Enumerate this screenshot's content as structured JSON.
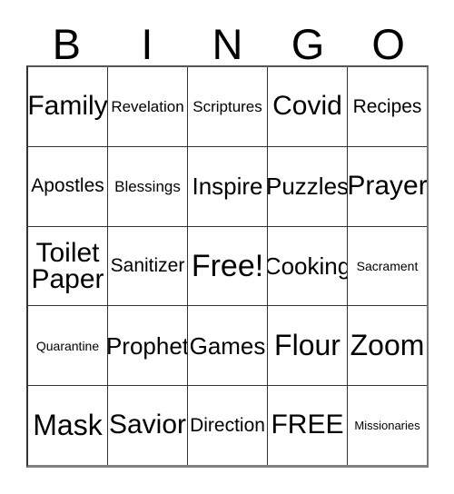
{
  "card": {
    "header_letters": [
      "B",
      "I",
      "N",
      "G",
      "O"
    ],
    "colors": {
      "background": "#ffffff",
      "text": "#000000",
      "grid_line": "#333333",
      "outer_border_bottom": "#808080"
    },
    "rows": [
      [
        {
          "text": "Family",
          "size": "lg"
        },
        {
          "text": "Revelation",
          "size": "xs"
        },
        {
          "text": "Scriptures",
          "size": "xs"
        },
        {
          "text": "Covid",
          "size": "lg"
        },
        {
          "text": "Recipes",
          "size": "sm"
        }
      ],
      [
        {
          "text": "Apostles",
          "size": "sm"
        },
        {
          "text": "Blessings",
          "size": "xs"
        },
        {
          "text": "Inspire",
          "size": "md"
        },
        {
          "text": "Puzzles",
          "size": "md"
        },
        {
          "text": "Prayer",
          "size": "lg"
        }
      ],
      [
        {
          "text": "Toilet Paper",
          "size": "lg",
          "wrap": true
        },
        {
          "text": "Sanitizer",
          "size": "sm"
        },
        {
          "text": "Free!",
          "size": "xxl"
        },
        {
          "text": "Cooking",
          "size": "md"
        },
        {
          "text": "Sacrament",
          "size": "xxs"
        }
      ],
      [
        {
          "text": "Quarantine",
          "size": "xxs"
        },
        {
          "text": "Prophet",
          "size": "md"
        },
        {
          "text": "Games",
          "size": "md"
        },
        {
          "text": "Flour",
          "size": "xl"
        },
        {
          "text": "Zoom",
          "size": "xl"
        }
      ],
      [
        {
          "text": "Mask",
          "size": "xl"
        },
        {
          "text": "Savior",
          "size": "lg"
        },
        {
          "text": "Direction",
          "size": "sm"
        },
        {
          "text": "FREE",
          "size": "lg"
        },
        {
          "text": "Missionaries",
          "size": "min"
        }
      ]
    ]
  }
}
